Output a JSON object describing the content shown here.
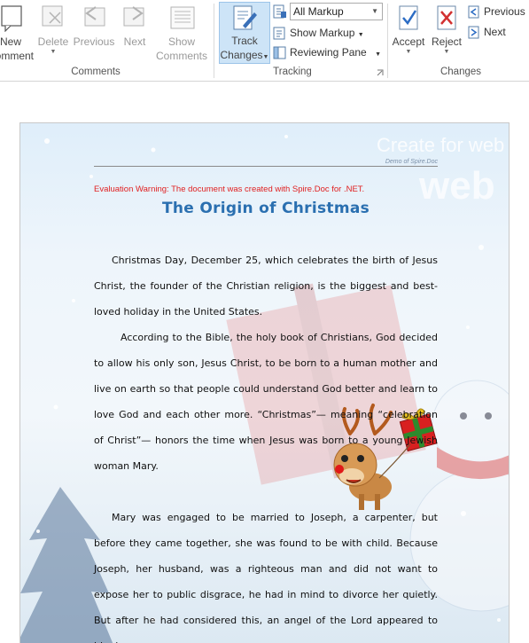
{
  "ribbon": {
    "comments_group": {
      "label": "Comments",
      "new_comment": "New\nComment",
      "delete": "Delete",
      "previous": "Previous",
      "next": "Next",
      "show_comments": "Show\nComments"
    },
    "tracking_group": {
      "label": "Tracking",
      "track_changes": "Track\nChanges",
      "markup_select": "All Markup",
      "show_markup": "Show Markup",
      "reviewing_pane": "Reviewing Pane"
    },
    "changes_group": {
      "label": "Changes",
      "accept": "Accept",
      "reject": "Reject",
      "previous": "Previous",
      "next": "Next"
    }
  },
  "document": {
    "header_right": "Demo of Spire.Doc",
    "watermark_text": "Create for web",
    "watermark_big": "web",
    "eval_warning": "Evaluation Warning: The document was created with Spire.Doc for .NET.",
    "title": "The Origin of Christmas",
    "paragraphs": [
      "Christmas Day, December 25, which celebrates the birth of Jesus Christ, the founder of the Christian religion, is the biggest and best-loved holiday in the United States.",
      "According to the Bible, the holy book of Christians, God decided to allow his only son, Jesus Christ, to be born to a human mother and live on earth so that people could understand God better and learn to love God and each other more. “Christmas”— meaning “celebration of Christ”— honors the time when Jesus was born to a young Jewish woman Mary.",
      "Mary was engaged to be married to Joseph, a carpenter, but before they came together, she was found to be with child. Because Joseph, her husband, was a righteous man and did not want to expose her to public disgrace, he had in mind to divorce her quietly. But after he had considered this, an angel of the Lord appeared to him in a"
    ]
  },
  "colors": {
    "title_blue": "#2a6fb0",
    "warning_red": "#e02020",
    "ribbon_active": "#cde4f7",
    "accept_blue": "#2b6cc4",
    "reject_red": "#d23030"
  }
}
